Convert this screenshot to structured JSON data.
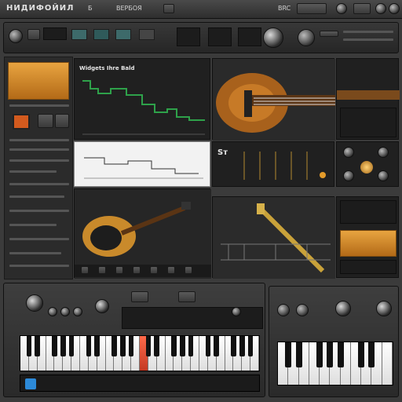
{
  "app": {
    "title": "НИДИФОЙИЛ",
    "menu": [
      "Б",
      "ВЕРБОЯ",
      "BRC"
    ]
  },
  "track_panel": {
    "heading": "Widgets Ihre Bald"
  },
  "sequencer": {
    "heading": "Sт"
  },
  "colors": {
    "accent_orange": "#d4892a",
    "panel_dark": "#1c1c1c",
    "green_line": "#2ea14a",
    "red_key": "#d9432b"
  },
  "icons": [
    "guitar-image",
    "saxophone-image",
    "knob",
    "keyboard"
  ]
}
